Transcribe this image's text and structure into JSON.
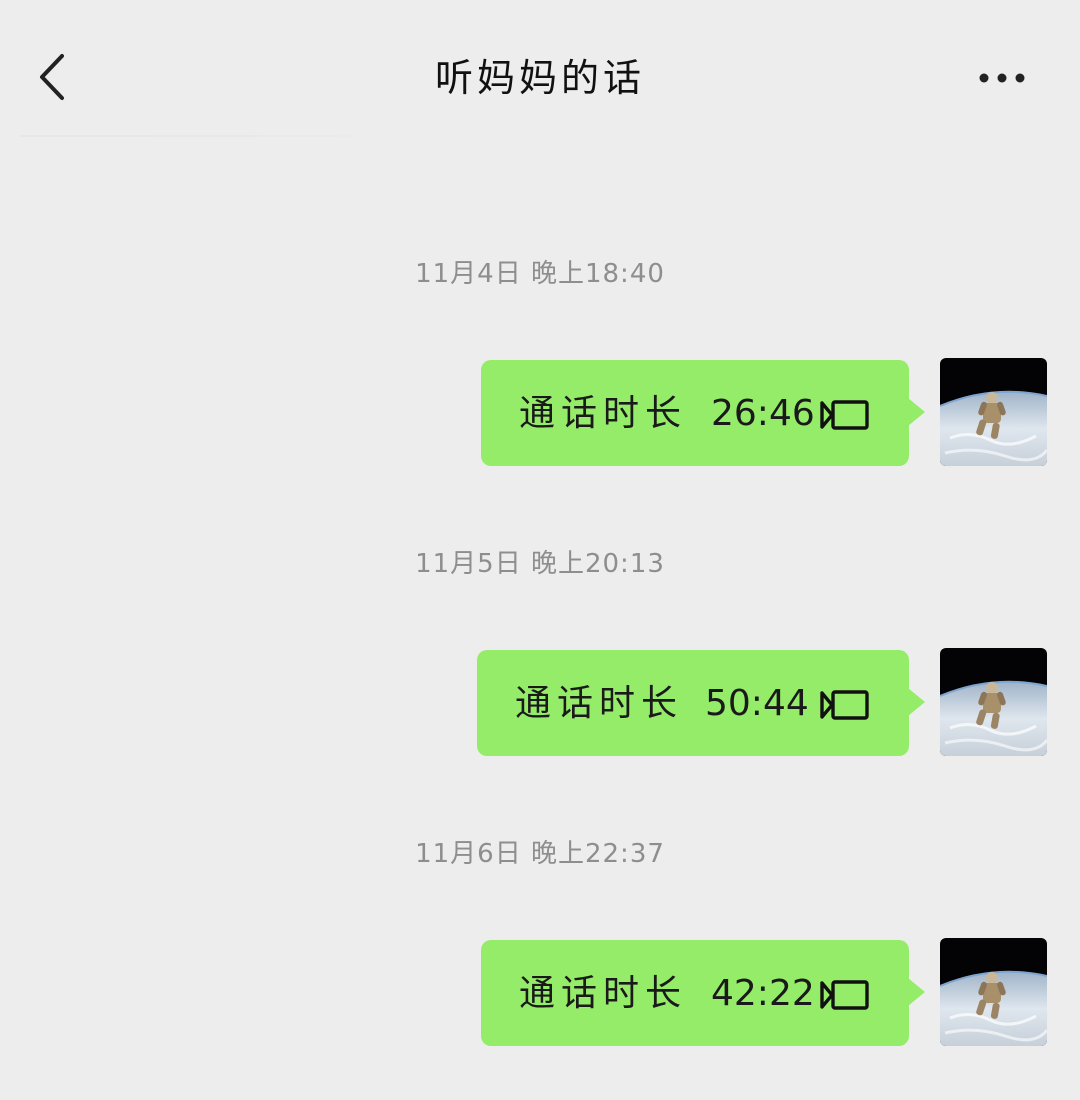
{
  "header": {
    "title": "听妈妈的话",
    "back_icon": "chevron-left-icon",
    "more_icon": "more-horizontal-icon"
  },
  "messages": [
    {
      "timestamp": "11月4日 晚上18:40",
      "label": "通话时长",
      "duration": "26:46",
      "icon": "video-call-icon"
    },
    {
      "timestamp": "11月5日 晚上20:13",
      "label": "通话时长",
      "duration": "50:44",
      "icon": "video-call-icon"
    },
    {
      "timestamp": "11月6日 晚上22:37",
      "label": "通话时长",
      "duration": "42:22",
      "icon": "video-call-icon"
    }
  ],
  "avatar_icon": "astronaut-avatar",
  "colors": {
    "background": "#ededed",
    "bubble": "#95ec69",
    "timestamp": "#8e8e8e"
  }
}
